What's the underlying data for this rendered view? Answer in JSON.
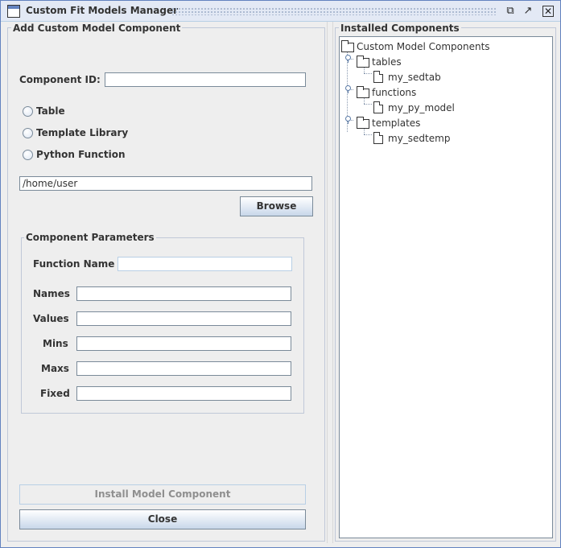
{
  "window": {
    "title": "Custom Fit Models Manager",
    "controls": {
      "minimize_icon": "minimize-icon",
      "maximize_icon": "maximize-icon",
      "close_icon": "close-icon"
    }
  },
  "add_panel": {
    "title": "Add Custom Model Component",
    "component_id_label": "Component ID:",
    "component_id_value": "",
    "radio_options": [
      {
        "label": "Table",
        "selected": false
      },
      {
        "label": "Template Library",
        "selected": false
      },
      {
        "label": "Python Function",
        "selected": false
      }
    ],
    "path_value": "/home/user",
    "browse_label": "Browse"
  },
  "parameters": {
    "title": "Component Parameters",
    "function_name_label": "Function Name",
    "function_name_value": "",
    "fields": [
      {
        "label": "Names",
        "value": ""
      },
      {
        "label": "Values",
        "value": ""
      },
      {
        "label": "Mins",
        "value": ""
      },
      {
        "label": "Maxs",
        "value": ""
      },
      {
        "label": "Fixed",
        "value": ""
      }
    ]
  },
  "actions": {
    "install_label": "Install Model Component",
    "install_enabled": false,
    "close_label": "Close"
  },
  "installed": {
    "title": "Installed Components",
    "root": "Custom Model Components",
    "folders": [
      {
        "name": "tables",
        "items": [
          "my_sedtab"
        ]
      },
      {
        "name": "functions",
        "items": [
          "my_py_model"
        ]
      },
      {
        "name": "templates",
        "items": [
          "my_sedtemp"
        ]
      }
    ]
  },
  "colors": {
    "title_bar": "#e3e9f5",
    "accent": "#6382bf",
    "panel_bg": "#eeeeee"
  }
}
